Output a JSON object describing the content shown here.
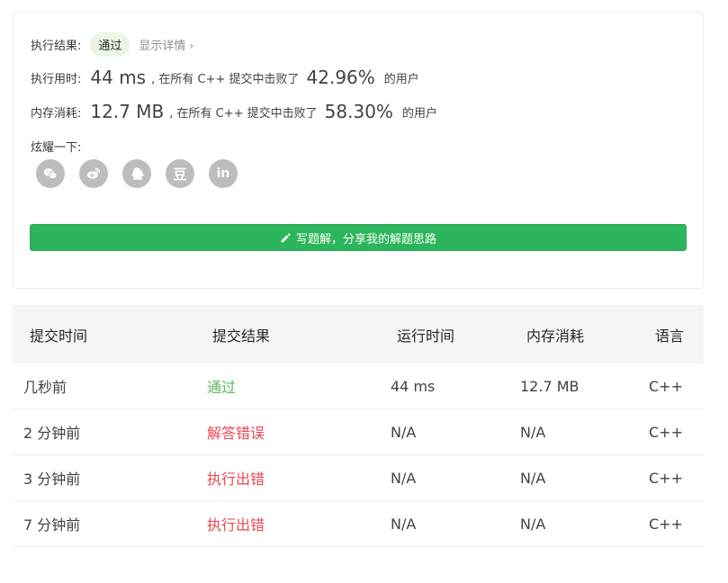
{
  "result": {
    "label": "执行结果:",
    "status": "通过",
    "detail": "显示详情",
    "detail_chevron": "›"
  },
  "time": {
    "label": "执行用时:",
    "value": "44 ms",
    "desc": ", 在所有 C++ 提交中击败了",
    "percent": "42.96%",
    "suffix": "的用户"
  },
  "memory": {
    "label": "内存消耗:",
    "value": "12.7 MB",
    "desc": ", 在所有 C++ 提交中击败了",
    "percent": "58.30%",
    "suffix": "的用户"
  },
  "share": {
    "label": "炫耀一下:",
    "icons": [
      "wechat-icon",
      "weibo-icon",
      "qq-icon",
      "douban-icon",
      "linkedin-icon"
    ],
    "douban_glyph": "豆",
    "linkedin_glyph": "in"
  },
  "write_button": {
    "label": "写题解，分享我的解题思路"
  },
  "table": {
    "headers": [
      "提交时间",
      "提交结果",
      "运行时间",
      "内存消耗",
      "语言"
    ],
    "rows": [
      {
        "time": "几秒前",
        "result": "通过",
        "runtime": "44 ms",
        "memory": "12.7 MB",
        "lang": "C++"
      },
      {
        "time": "2 分钟前",
        "result": "解答错误",
        "runtime": "N/A",
        "memory": "N/A",
        "lang": "C++"
      },
      {
        "time": "3 分钟前",
        "result": "执行出错",
        "runtime": "N/A",
        "memory": "N/A",
        "lang": "C++"
      },
      {
        "time": "7 分钟前",
        "result": "执行出错",
        "runtime": "N/A",
        "memory": "N/A",
        "lang": "C++"
      }
    ]
  },
  "colors": {
    "accent_green": "#2db55d",
    "status_pass": "#5cb85c",
    "status_error": "#e9474f",
    "icon_gray": "#bdbdbd"
  }
}
